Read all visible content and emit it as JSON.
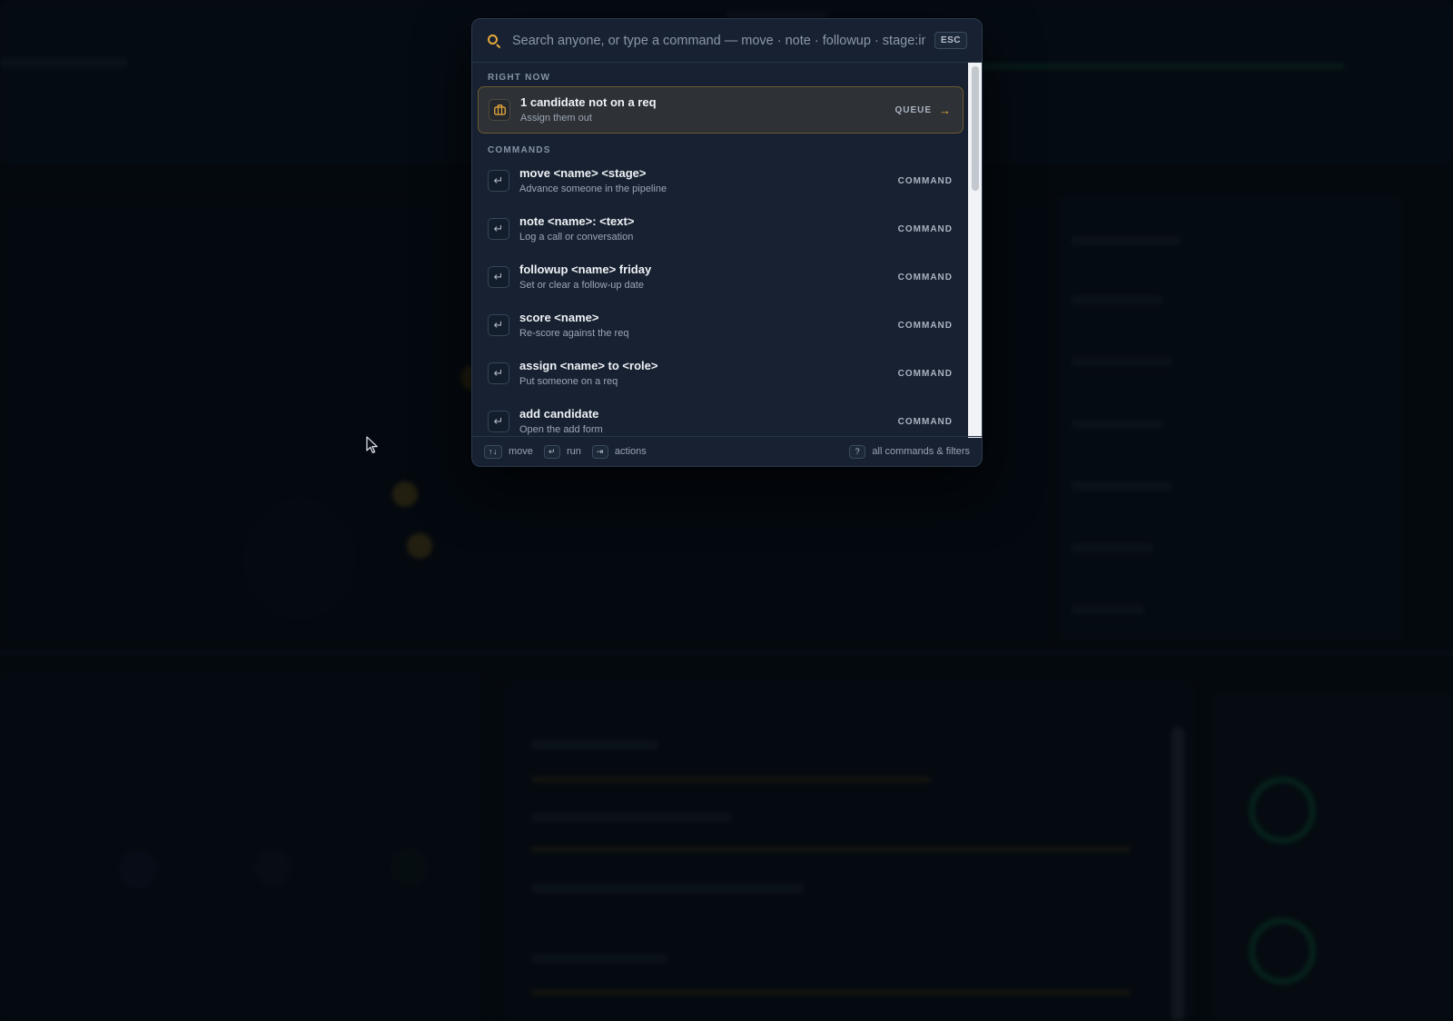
{
  "search": {
    "placeholder": "Search anyone, or type a command — move · note · followup · stage:inter",
    "esc_label": "ESC"
  },
  "sections": {
    "right_now": "RIGHT NOW",
    "commands": "COMMANDS"
  },
  "right_now_item": {
    "title": "1 candidate not on a req",
    "subtitle": "Assign them out",
    "tag": "QUEUE",
    "icon": "briefcase-icon"
  },
  "commands": [
    {
      "title": "move <name> <stage>",
      "subtitle": "Advance someone in the pipeline",
      "tag": "COMMAND"
    },
    {
      "title": "note <name>: <text>",
      "subtitle": "Log a call or conversation",
      "tag": "COMMAND"
    },
    {
      "title": "followup <name> friday",
      "subtitle": "Set or clear a follow-up date",
      "tag": "COMMAND"
    },
    {
      "title": "score <name>",
      "subtitle": "Re-score against the req",
      "tag": "COMMAND"
    },
    {
      "title": "assign <name> to <role>",
      "subtitle": "Put someone on a req",
      "tag": "COMMAND"
    },
    {
      "title": "add candidate",
      "subtitle": "Open the add form",
      "tag": "COMMAND"
    }
  ],
  "footer": {
    "move_key": "↑↓",
    "move_label": "move",
    "run_key": "↵",
    "run_label": "run",
    "actions_key": "⇥",
    "actions_label": "actions",
    "help_key": "?",
    "help_label": "all commands & filters"
  },
  "colors": {
    "accent": "#e9a93b",
    "palette_bg": "#172131",
    "active_row_bg": "#2e3135"
  }
}
